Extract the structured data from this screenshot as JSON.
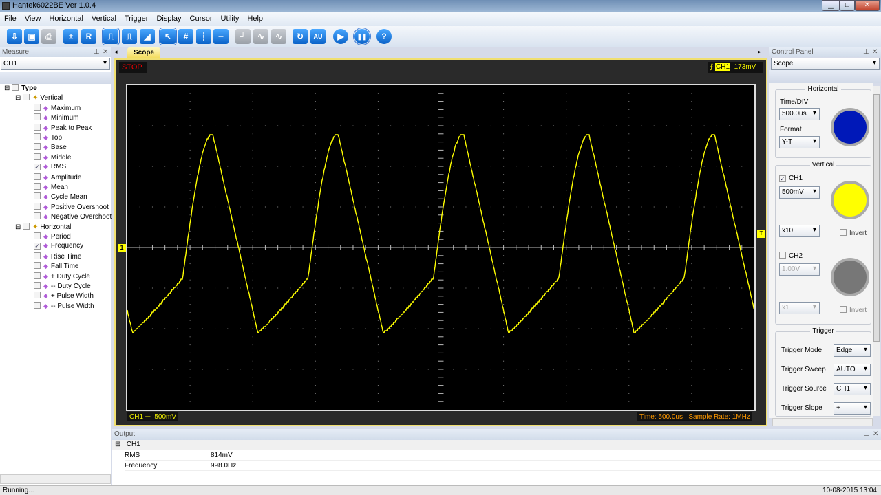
{
  "window": {
    "title": "Hantek6022BE Ver 1.0.4",
    "min": "▁",
    "max": "□",
    "close": "✕"
  },
  "menu": [
    "File",
    "View",
    "Horizontal",
    "Vertical",
    "Trigger",
    "Display",
    "Cursor",
    "Utility",
    "Help"
  ],
  "toolbar": [
    {
      "name": "open-icon",
      "glyph": "⇩",
      "style": "blue"
    },
    {
      "name": "save-icon",
      "glyph": "▣",
      "style": "blue"
    },
    {
      "name": "print-icon",
      "glyph": "⎙",
      "style": "grey"
    },
    {
      "name": "math-icon",
      "glyph": "±",
      "style": "blue"
    },
    {
      "name": "reference-icon",
      "glyph": "R",
      "style": "blue"
    },
    {
      "name": "pulse-icon",
      "glyph": "⎍",
      "style": "blue",
      "sel": true
    },
    {
      "name": "square-wave-icon",
      "glyph": "⎍",
      "style": "blue"
    },
    {
      "name": "ramp-icon",
      "glyph": "◢",
      "style": "blue"
    },
    {
      "name": "pointer-icon",
      "glyph": "↖",
      "style": "blue",
      "sel": true
    },
    {
      "name": "cross-cursor-icon",
      "glyph": "#",
      "style": "blue"
    },
    {
      "name": "vertical-cursor-icon",
      "glyph": "┆",
      "style": "blue"
    },
    {
      "name": "horizontal-cursor-icon",
      "glyph": "┄",
      "style": "blue"
    },
    {
      "name": "step-icon",
      "glyph": "┘",
      "style": "grey"
    },
    {
      "name": "wave-icon",
      "glyph": "∿",
      "style": "grey"
    },
    {
      "name": "sine-icon",
      "glyph": "∿",
      "style": "grey"
    },
    {
      "name": "refresh-icon",
      "glyph": "↻",
      "style": "blue"
    },
    {
      "name": "auto-icon",
      "glyph": "AU",
      "style": "blue"
    },
    {
      "name": "run-icon",
      "glyph": "▶",
      "style": "blue round"
    },
    {
      "name": "pause-icon",
      "glyph": "❚❚",
      "style": "blue round",
      "sel": true
    },
    {
      "name": "help-icon",
      "glyph": "?",
      "style": "blue round"
    }
  ],
  "measure": {
    "title": "Measure",
    "channel": "CH1",
    "root": "Type",
    "groups": [
      {
        "label": "Vertical",
        "items": [
          {
            "label": "Maximum",
            "checked": false
          },
          {
            "label": "Minimum",
            "checked": false
          },
          {
            "label": "Peak to Peak",
            "checked": false
          },
          {
            "label": "Top",
            "checked": false
          },
          {
            "label": "Base",
            "checked": false
          },
          {
            "label": "Middle",
            "checked": false
          },
          {
            "label": "RMS",
            "checked": true
          },
          {
            "label": "Amplitude",
            "checked": false
          },
          {
            "label": "Mean",
            "checked": false
          },
          {
            "label": "Cycle Mean",
            "checked": false
          },
          {
            "label": "Positive Overshoot",
            "checked": false
          },
          {
            "label": "Negative Overshoot",
            "checked": false
          }
        ]
      },
      {
        "label": "Horizontal",
        "items": [
          {
            "label": "Period",
            "checked": false
          },
          {
            "label": "Frequency",
            "checked": true
          },
          {
            "label": "Rise Time",
            "checked": false
          },
          {
            "label": "Fall Time",
            "checked": false
          },
          {
            "label": "+ Duty Cycle",
            "checked": false
          },
          {
            "label": "-- Duty Cycle",
            "checked": false
          },
          {
            "label": "+ Pulse Width",
            "checked": false
          },
          {
            "label": "-- Pulse Width",
            "checked": false
          }
        ]
      }
    ]
  },
  "scope": {
    "tab": "Scope",
    "status": "STOP",
    "trigger_channel": "CH1",
    "trigger_level": "173mV",
    "ch_label": "CH1 ⎓",
    "ch_scale": "500mV",
    "time": "Time: 500.0us",
    "sample_rate": "Sample Rate: 1MHz",
    "ch1_marker": "1",
    "trigger_marker": "T",
    "trace_color": "#ffff00"
  },
  "control": {
    "title": "Control Panel",
    "mode": "Scope",
    "horizontal": {
      "title": "Horizontal",
      "timediv_label": "Time/DIV",
      "timediv": "500.0us",
      "format_label": "Format",
      "format": "Y-T"
    },
    "vertical": {
      "title": "Vertical",
      "ch1": "CH1",
      "ch1_checked": true,
      "ch1_scale": "500mV",
      "ch1_probe": "x10",
      "invert": "Invert",
      "ch2": "CH2",
      "ch2_checked": false,
      "ch2_scale": "1.00V",
      "ch2_probe": "x1"
    },
    "trigger": {
      "title": "Trigger",
      "rows": [
        {
          "label": "Trigger Mode",
          "value": "Edge"
        },
        {
          "label": "Trigger Sweep",
          "value": "AUTO"
        },
        {
          "label": "Trigger Source",
          "value": "CH1"
        },
        {
          "label": "Trigger Slope",
          "value": "+"
        }
      ]
    }
  },
  "output": {
    "title": "Output",
    "channel": "CH1",
    "rows": [
      {
        "name": "RMS",
        "value": "814mV"
      },
      {
        "name": "Frequency",
        "value": "998.0Hz"
      }
    ]
  },
  "status": {
    "left": "Running...",
    "right": "10-08-2015  13:04"
  }
}
